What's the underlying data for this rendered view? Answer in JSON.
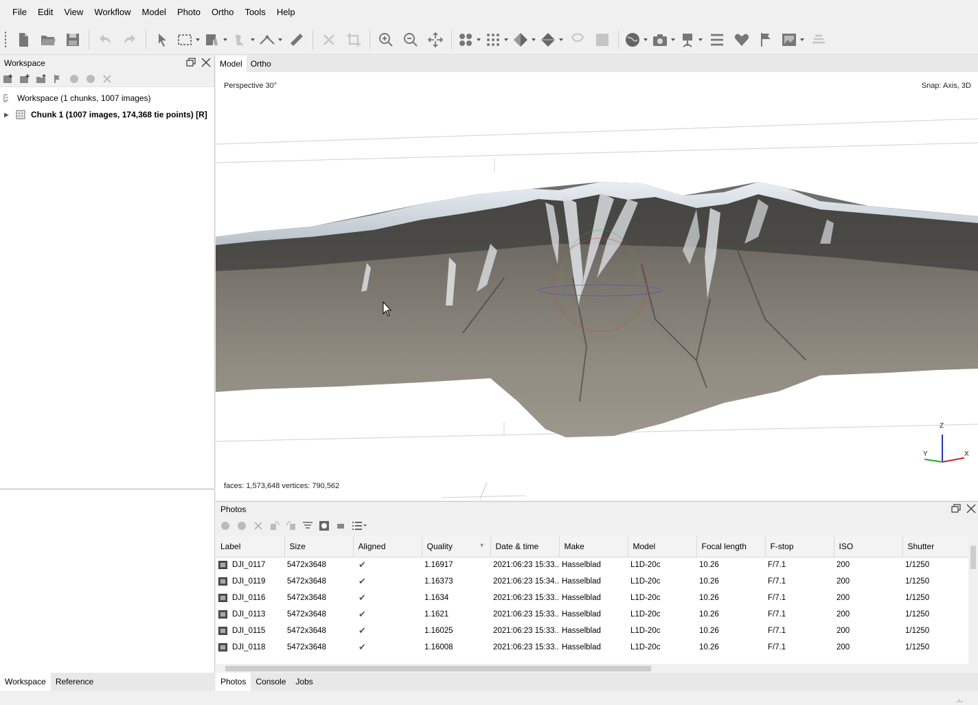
{
  "menu": [
    "File",
    "Edit",
    "View",
    "Workflow",
    "Model",
    "Photo",
    "Ortho",
    "Tools",
    "Help"
  ],
  "toolbar_icons": [
    "new-icon",
    "open-icon",
    "save-icon",
    "undo-icon",
    "redo-icon",
    "navigation-icon",
    "rectangle-selection-icon",
    "draw-polygon-icon",
    "draw-point-icon",
    "draw-polyline-icon",
    "ruler-icon",
    "delete-icon",
    "crop-icon",
    "zoom-in-icon",
    "zoom-out-icon",
    "reset-view-icon",
    "tie-points-icon",
    "point-cloud-icon",
    "mesh-shaded-icon",
    "mesh-solid-icon",
    "tiled-model-icon",
    "dem-icon",
    "texture-icon",
    "cameras-icon",
    "camera-show-icon",
    "markers-icon",
    "shapes-icon",
    "flags-icon",
    "image-icon",
    "region-icon"
  ],
  "workspace": {
    "title": "Workspace",
    "root": "Workspace (1 chunks, 1007 images)",
    "chunk": "Chunk 1 (1007 images, 174,368 tie points) [R]"
  },
  "left_tabs": [
    "Workspace",
    "Reference"
  ],
  "view_tabs": [
    "Model",
    "Ortho"
  ],
  "viewport": {
    "projection": "Perspective 30°",
    "snap": "Snap: Axis, 3D",
    "stats": "faces: 1,573,648 vertices: 790,562",
    "axes": {
      "z": "Z",
      "y": "Y",
      "x": "X"
    }
  },
  "photos": {
    "title": "Photos",
    "columns": [
      "Label",
      "Size",
      "Aligned",
      "Quality",
      "Date & time",
      "Make",
      "Model",
      "Focal length",
      "F-stop",
      "ISO",
      "Shutter"
    ],
    "rows": [
      {
        "label": "DJI_0117",
        "size": "5472x3648",
        "aligned": "✔",
        "quality": "1.16917",
        "date": "2021:06:23 15:33...",
        "make": "Hasselblad",
        "model": "L1D-20c",
        "focal": "10.26",
        "fstop": "F/7.1",
        "iso": "200",
        "shutter": "1/1250"
      },
      {
        "label": "DJI_0119",
        "size": "5472x3648",
        "aligned": "✔",
        "quality": "1.16373",
        "date": "2021:06:23 15:34...",
        "make": "Hasselblad",
        "model": "L1D-20c",
        "focal": "10.26",
        "fstop": "F/7.1",
        "iso": "200",
        "shutter": "1/1250"
      },
      {
        "label": "DJI_0116",
        "size": "5472x3648",
        "aligned": "✔",
        "quality": "1.1634",
        "date": "2021:06:23 15:33...",
        "make": "Hasselblad",
        "model": "L1D-20c",
        "focal": "10.26",
        "fstop": "F/7.1",
        "iso": "200",
        "shutter": "1/1250"
      },
      {
        "label": "DJI_0113",
        "size": "5472x3648",
        "aligned": "✔",
        "quality": "1.1621",
        "date": "2021:06:23 15:33...",
        "make": "Hasselblad",
        "model": "L1D-20c",
        "focal": "10.26",
        "fstop": "F/7.1",
        "iso": "200",
        "shutter": "1/1250"
      },
      {
        "label": "DJI_0115",
        "size": "5472x3648",
        "aligned": "✔",
        "quality": "1.16025",
        "date": "2021:06:23 15:33...",
        "make": "Hasselblad",
        "model": "L1D-20c",
        "focal": "10.26",
        "fstop": "F/7.1",
        "iso": "200",
        "shutter": "1/1250"
      },
      {
        "label": "DJI_0118",
        "size": "5472x3648",
        "aligned": "✔",
        "quality": "1.16008",
        "date": "2021:06:23 15:33...",
        "make": "Hasselblad",
        "model": "L1D-20c",
        "focal": "10.26",
        "fstop": "F/7.1",
        "iso": "200",
        "shutter": "1/1250"
      }
    ]
  },
  "bottom_tabs": [
    "Photos",
    "Console",
    "Jobs"
  ]
}
